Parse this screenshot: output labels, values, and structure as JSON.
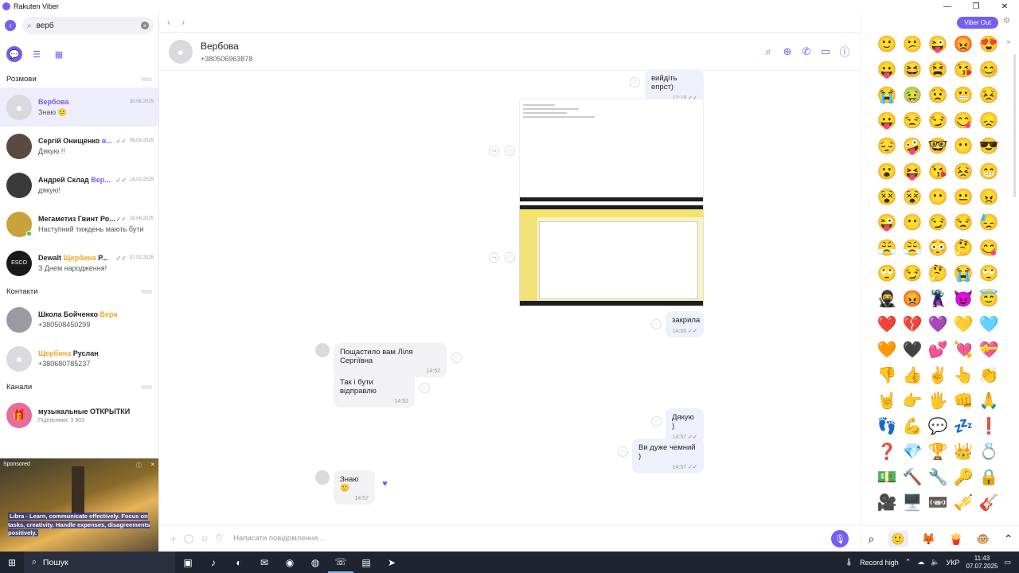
{
  "window": {
    "title": "Rakuten Viber"
  },
  "search": {
    "value": "верб"
  },
  "sections": {
    "chats": "Розмови",
    "contacts": "Контакти",
    "channels": "Канали"
  },
  "chats": [
    {
      "name": "Вербова",
      "name_hl": "",
      "name_rest": "",
      "date": "30.06.2025",
      "preview": "Знаю 🙂"
    },
    {
      "name": "Сергій Онищенко ",
      "name_hl": "в...",
      "name_rest": "",
      "date": "08.03.2025",
      "preview": "Дякую !!"
    },
    {
      "name": "Андрей Склад ",
      "name_hl": "Вер...",
      "name_rest": "",
      "date": "18.02.2025",
      "preview": "дякую!"
    },
    {
      "name": "Мегаметиз Гвинт Ро...",
      "name_hl": "",
      "name_rest": "",
      "date": "16.06.2025",
      "preview": "Наступний тиждень мають бути"
    },
    {
      "name": "Dewalt ",
      "name_hl": "Щербина",
      "name_rest": " Р...",
      "date": "07.02.2025",
      "preview": "З Днем народження!"
    }
  ],
  "contacts": [
    {
      "name": "Школа Бойченко ",
      "name_hl": "Вера",
      "sub": "+380508450299"
    },
    {
      "name": "",
      "name_hl": "Щербина",
      "name_rest": " Руслан",
      "sub": "+380680785237"
    }
  ],
  "channels": [
    {
      "name": "музыкальные ОТКРЫТКИ",
      "sub": "Підписники: 3 903"
    }
  ],
  "ad": {
    "sponsored": "Sponsored",
    "text": "Libra - Learn, communicate effectively. Focus on tasks, creativity. Handle expenses, disagreements positively."
  },
  "chat_header": {
    "name": "Вербова",
    "phone": "+380506963878"
  },
  "messages": [
    {
      "text": "вийдіть епрст)",
      "time": "12:19"
    },
    {
      "text": "закрила",
      "time": "14:50"
    },
    {
      "text": "Пощастило вам Ліля Сергіївна",
      "time": "14:52"
    },
    {
      "text": "Так і бути відправлю",
      "time": "14:52"
    },
    {
      "text": "Дякую )",
      "time": "14:57"
    },
    {
      "text": "Ви дуже чемний )",
      "time": "14:57"
    },
    {
      "text": "Знаю 🙂",
      "time": "14:57"
    }
  ],
  "composer": {
    "placeholder": "Написати повідомлення..."
  },
  "viber_out": "Viber Out",
  "emojis": [
    "🙂",
    "😕",
    "😜",
    "😡",
    "😍",
    "😛",
    "😆",
    "😫",
    "😘",
    "😊",
    "😭",
    "🤢",
    "😟",
    "😬",
    "😣",
    "😛",
    "😒",
    "😏",
    "😋",
    "😞",
    "😔",
    "🤪",
    "🤓",
    "😶",
    "😎",
    "😮",
    "😝",
    "😘",
    "😣",
    "😁",
    "😵",
    "😵",
    "😶",
    "😐",
    "😠",
    "😜",
    "😶",
    "😏",
    "😒",
    "😓",
    "😤",
    "😤",
    "😳",
    "🤔",
    "😋",
    "🙄",
    "😏",
    "🤔",
    "😭",
    "🙄",
    "🥷",
    "😡",
    "🦹",
    "😈",
    "😇",
    "❤️",
    "💔",
    "💜",
    "💛",
    "🩵",
    "🧡",
    "🖤",
    "💕",
    "💘",
    "💝",
    "👎",
    "👍",
    "✌️",
    "👆",
    "👏",
    "🤘",
    "👉",
    "🖐️",
    "👊",
    "🙏",
    "👣",
    "💪",
    "💬",
    "💤",
    "❗",
    "❓",
    "💎",
    "🏆",
    "👑",
    "💍",
    "💵",
    "🔨",
    "🔧",
    "🔑",
    "🔒",
    "🎥",
    "🖥️",
    "📼",
    "🎺",
    "🎸"
  ],
  "taskbar": {
    "search": "Пошук",
    "record": "Record high",
    "lang": "УКР",
    "time": "11:43",
    "date": "07.07.2025"
  }
}
